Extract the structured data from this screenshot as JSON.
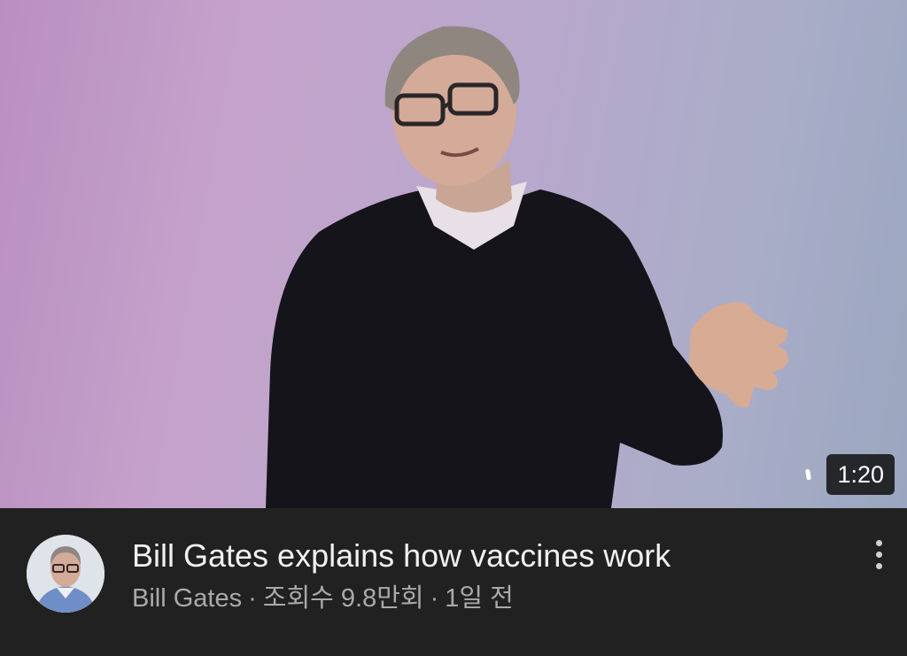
{
  "video": {
    "duration": "1:20",
    "title": "Bill Gates explains how vaccines work",
    "channel": "Bill Gates",
    "views": "조회수 9.8만회",
    "age": "1일 전",
    "separator": "·"
  },
  "icons": {
    "more": "more-vert-icon"
  }
}
